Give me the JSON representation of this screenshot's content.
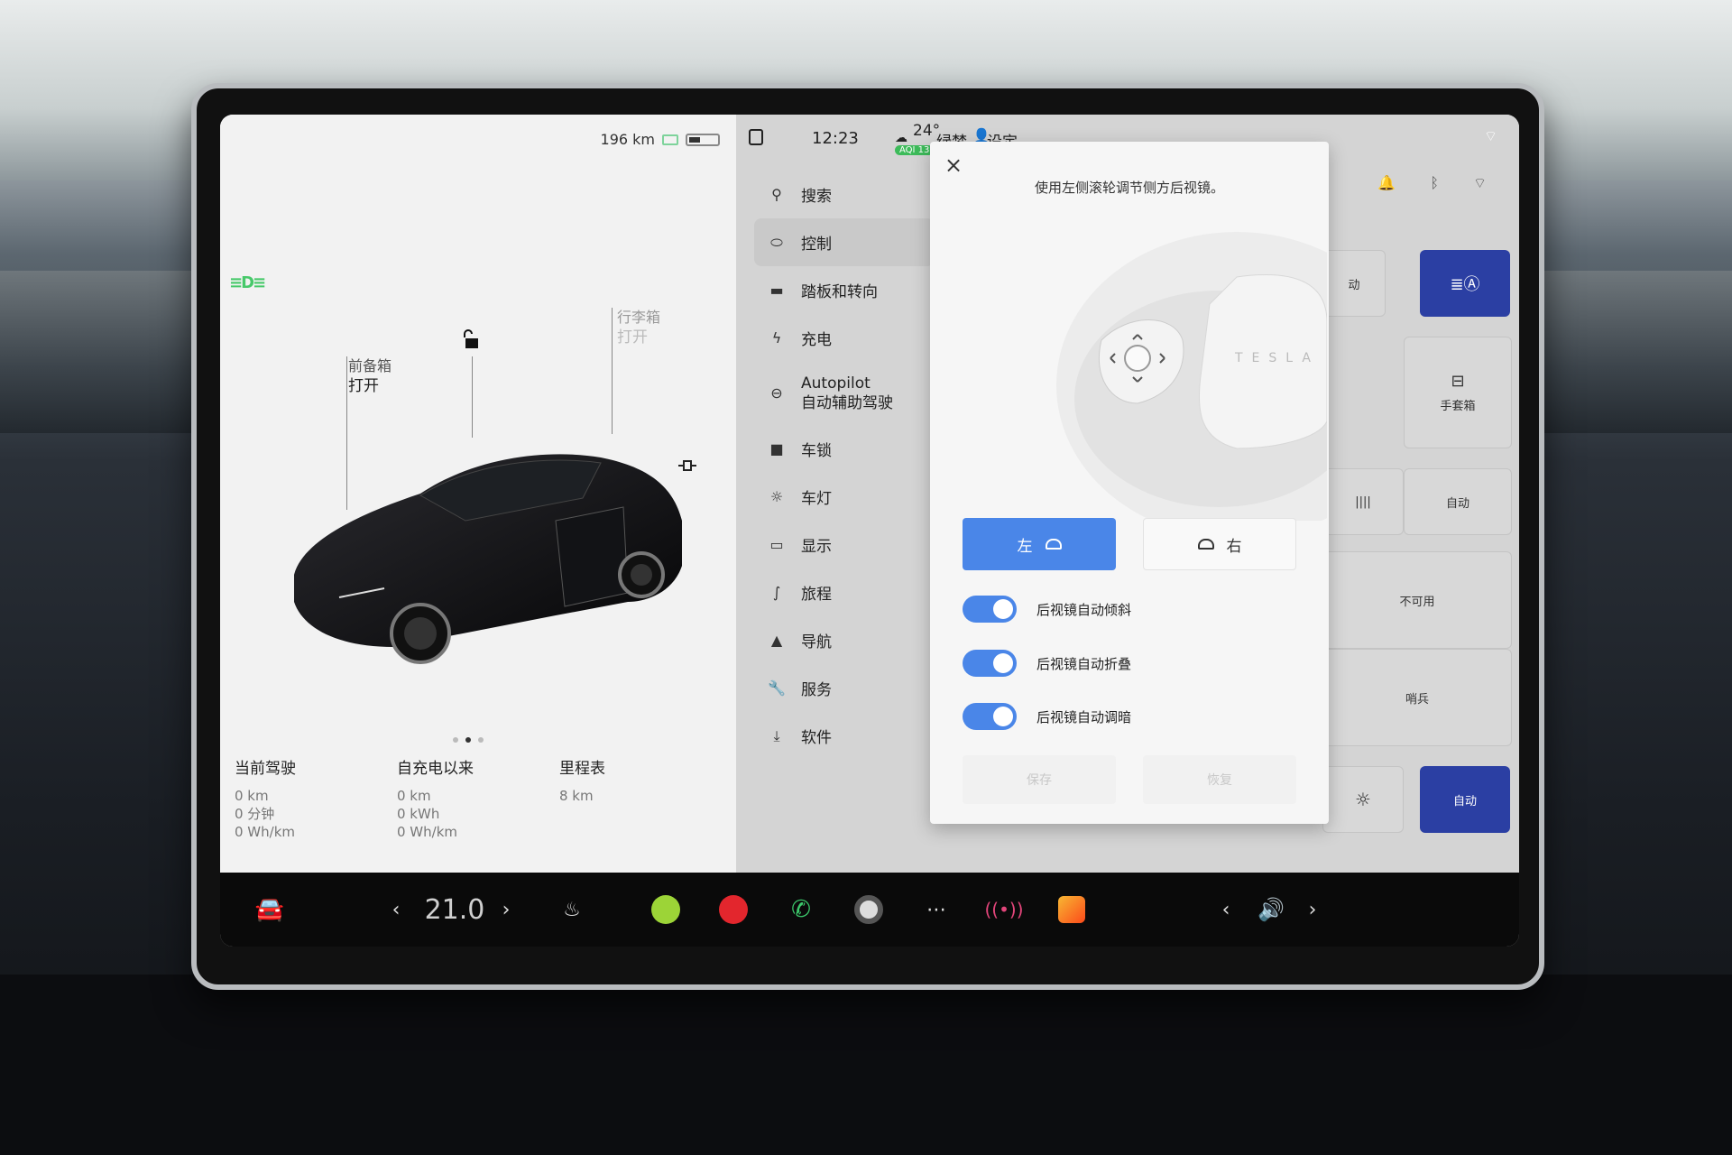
{
  "status": {
    "range": "196 km",
    "time": "12:23",
    "weather_temp": "24°",
    "aqi": "AQI 13",
    "profile_label": "绿梦",
    "settings_label": "设定"
  },
  "car_panel": {
    "frunk": {
      "label": "前备箱",
      "value": "打开"
    },
    "trunk": {
      "label": "行李箱",
      "value": "打开"
    },
    "stats": [
      {
        "title": "当前驾驶",
        "lines": [
          "0 km",
          "0 分钟",
          "0 Wh/km"
        ]
      },
      {
        "title": "自充电以来",
        "lines": [
          "0 km",
          "0 kWh",
          "0 Wh/km"
        ]
      },
      {
        "title": "里程表",
        "lines": [
          "8 km"
        ]
      }
    ],
    "page_dots": 3,
    "active_dot": 1
  },
  "menu": {
    "items": [
      {
        "label": "搜索",
        "icon": "search-icon"
      },
      {
        "label": "控制",
        "icon": "toggle-icon",
        "active": true
      },
      {
        "label": "踏板和转向",
        "icon": "car-icon"
      },
      {
        "label": "充电",
        "icon": "bolt-icon"
      },
      {
        "label": "Autopilot",
        "label2": "自动辅助驾驶",
        "icon": "steering-icon"
      },
      {
        "label": "车锁",
        "icon": "lock-icon"
      },
      {
        "label": "车灯",
        "icon": "sun-icon"
      },
      {
        "label": "显示",
        "icon": "display-icon"
      },
      {
        "label": "旅程",
        "icon": "trip-icon"
      },
      {
        "label": "导航",
        "icon": "navigation-icon"
      },
      {
        "label": "服务",
        "icon": "wrench-icon"
      },
      {
        "label": "软件",
        "icon": "download-icon"
      }
    ]
  },
  "tiles": {
    "glovebox": "手套箱",
    "auto_1": "动",
    "auto_2": "自动",
    "unavailable": "不可用",
    "sentry": "哨兵",
    "auto_blue": "自动"
  },
  "modal": {
    "hint": "使用左侧滚轮调节侧方后视镜。",
    "left_label": "左",
    "right_label": "右",
    "toggles": [
      {
        "label": "后视镜自动倾斜",
        "on": true
      },
      {
        "label": "后视镜自动折叠",
        "on": true
      },
      {
        "label": "后视镜自动调暗",
        "on": true
      }
    ],
    "save_label": "保存",
    "restore_label": "恢复"
  },
  "bottom_bar": {
    "temperature": "21.0"
  },
  "colors": {
    "accent_blue": "#4a86e8",
    "tile_blue": "#2b3fa3",
    "headlight_green": "#47c96a"
  }
}
